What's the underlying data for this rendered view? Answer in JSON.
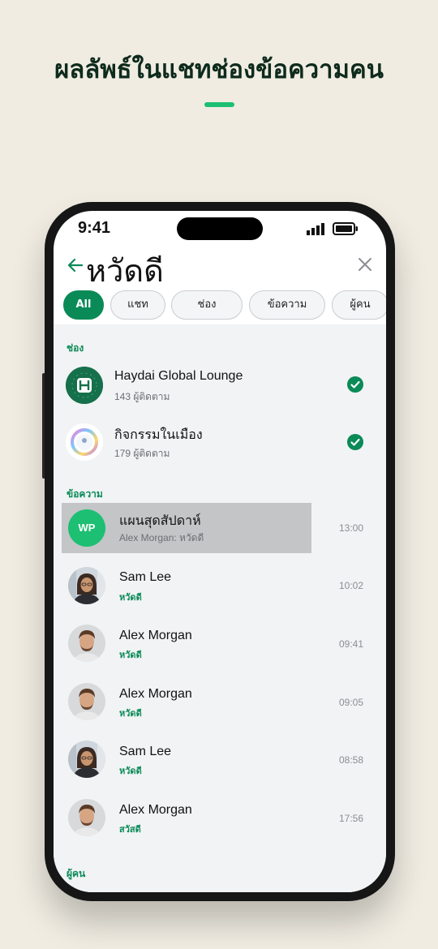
{
  "headline": "ผลลัพธ์ในแชทช่องข้อความคน",
  "status": {
    "time": "9:41"
  },
  "search": {
    "query": "หวัดดี"
  },
  "filters": [
    {
      "label": "All",
      "active": true
    },
    {
      "label": "แชท",
      "active": false
    },
    {
      "label": "ช่อง",
      "active": false
    },
    {
      "label": "ข้อความ",
      "active": false
    },
    {
      "label": "ผู้คน",
      "active": false
    }
  ],
  "sections": {
    "channels": "ช่อง",
    "messages": "ข้อความ",
    "people": "ผู้คน"
  },
  "channels": [
    {
      "name": "Haydai Global Lounge",
      "followers": "143 ผู้ติดตาม",
      "avatar_icon": "haydai-logo-icon",
      "joined": true
    },
    {
      "name": "กิจกรรมในเมือง",
      "followers": "179 ผู้ติดตาม",
      "avatar_icon": "rainbow-ring-logo-icon",
      "joined": true
    }
  ],
  "messages": [
    {
      "name": "แผนสุดสัปดาห์",
      "preview": "Alex Morgan: หวัดดี",
      "time": "13:00",
      "avatar_initials": "WP",
      "highlighted": true
    },
    {
      "name": "Sam Lee",
      "preview": "หวัดดี",
      "time": "10:02",
      "avatar": "female"
    },
    {
      "name": "Alex Morgan",
      "preview": "หวัดดี",
      "time": "09:41",
      "avatar": "male"
    },
    {
      "name": "Alex Morgan",
      "preview": "หวัดดี",
      "time": "09:05",
      "avatar": "male"
    },
    {
      "name": "Sam Lee",
      "preview": "หวัดดี",
      "time": "08:58",
      "avatar": "female"
    },
    {
      "name": "Alex Morgan",
      "preview": "สวัสดี",
      "time": "17:56",
      "avatar": "male"
    }
  ],
  "colors": {
    "accent": "#0a8a57",
    "brand_green": "#1dbf73",
    "background": "#f0ece2"
  }
}
